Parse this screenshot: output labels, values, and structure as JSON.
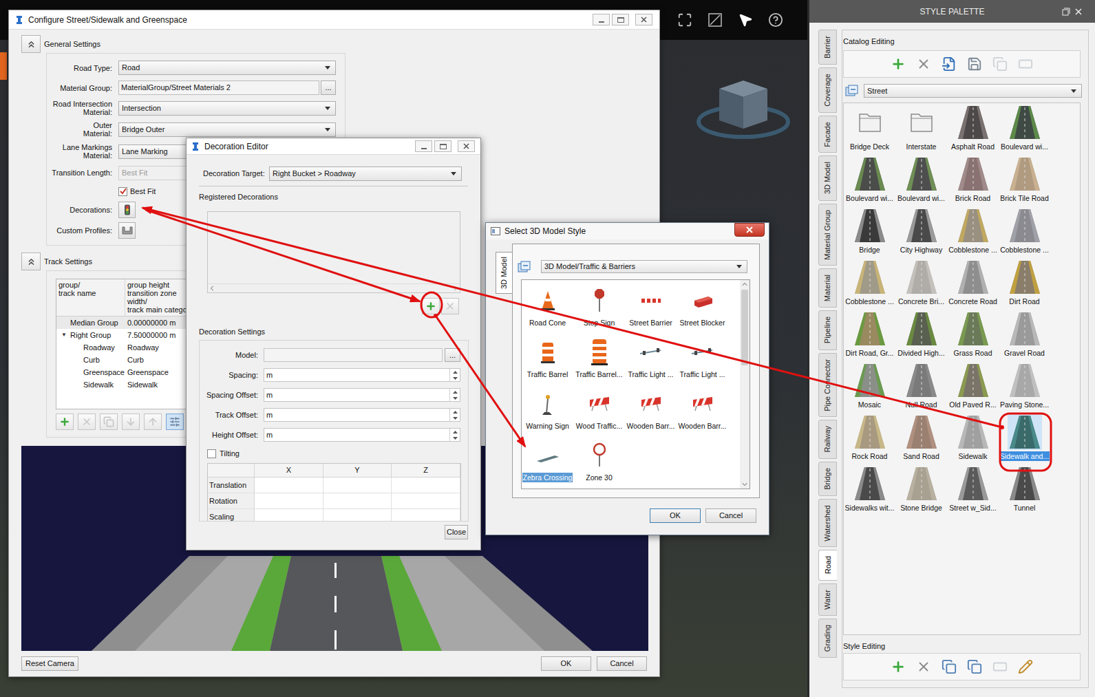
{
  "main_window": {
    "title": "Configure Street/Sidewalk and Greenspace",
    "general": {
      "title": "General Settings",
      "expanded": true,
      "fields": [
        {
          "kind": "combo",
          "label": [
            "Road Type:"
          ],
          "value": "Road",
          "disabled": false
        },
        {
          "kind": "browse",
          "label": [
            "Material Group:"
          ],
          "value": "MaterialGroup/Street Materials 2",
          "button": "...",
          "disabled": false
        },
        {
          "kind": "combo",
          "label": [
            "Road Intersection",
            "Material:"
          ],
          "value": "Intersection",
          "disabled": false
        },
        {
          "kind": "combo",
          "label": [
            "Outer",
            "Material:"
          ],
          "value": "Bridge Outer",
          "disabled": false
        },
        {
          "kind": "combo",
          "label": [
            "Lane Markings",
            "Material:"
          ],
          "value": "Lane Marking",
          "disabled": false
        },
        {
          "kind": "combo",
          "label": [
            "Transition Length:"
          ],
          "value": "Best Fit",
          "disabled": true
        },
        {
          "kind": "checkbox",
          "label": [],
          "value": "Best Fit",
          "checked": true,
          "disabled": false
        },
        {
          "kind": "decorations",
          "label": [
            "Decorations:"
          ],
          "disabled": false
        },
        {
          "kind": "profiles",
          "label": [
            "Custom Profiles:"
          ],
          "disabled": false
        }
      ]
    },
    "track": {
      "title": "Track Settings",
      "expanded": true,
      "expand_glyph": "▼",
      "columns": [
        [
          "group/",
          "track name"
        ],
        [
          "group height",
          "transition zone",
          "width/",
          "track main categor"
        ]
      ],
      "rows": [
        {
          "name": "Median Group",
          "value": "0.00000000 m",
          "kind": "group",
          "has_children": false
        },
        {
          "name": "Right Group",
          "value": "7.50000000 m",
          "kind": "group",
          "has_children": true
        },
        {
          "name": "Roadway",
          "value": "Roadway",
          "kind": "track",
          "has_children": false
        },
        {
          "name": "Curb",
          "value": "Curb",
          "kind": "track",
          "has_children": false
        },
        {
          "name": "Greenspace",
          "value": "Greenspace",
          "kind": "track",
          "has_children": false
        },
        {
          "name": "Sidewalk",
          "value": "Sidewalk",
          "kind": "track",
          "has_children": false
        }
      ],
      "tools": [
        {
          "disabled": false,
          "pressed": false
        },
        {
          "disabled": true,
          "pressed": false
        },
        {
          "disabled": true,
          "pressed": false
        },
        {
          "disabled": true,
          "pressed": false
        },
        {
          "disabled": true,
          "pressed": false
        },
        {
          "disabled": false,
          "pressed": true
        }
      ]
    },
    "buttons": {
      "reset": "Reset Camera",
      "ok": "OK",
      "cancel": "Cancel"
    }
  },
  "decoration_editor": {
    "title": "Decoration Editor",
    "target_label": "Decoration Target:",
    "target": "Right Bucket > Roadway",
    "registered_title": "Registered Decorations",
    "registered": [],
    "tools": [
      {
        "disabled": false
      },
      {
        "disabled": true
      }
    ],
    "settings_title": "Decoration Settings",
    "model": {
      "label": "Model:",
      "value": "",
      "button": "..."
    },
    "spins": [
      {
        "label": "Spacing:",
        "value": "m"
      },
      {
        "label": "Spacing Offset:",
        "value": "m"
      },
      {
        "label": "Track Offset:",
        "value": "m"
      },
      {
        "label": "Height Offset:",
        "value": "m"
      }
    ],
    "tilting": {
      "label": "Tilting",
      "checked": false
    },
    "transform": {
      "columns": [
        "X",
        "Y",
        "Z"
      ],
      "rows": [
        "Translation",
        "Rotation",
        "Scaling"
      ]
    },
    "close": "Close"
  },
  "model_dialog": {
    "title": "Select 3D Model Style",
    "tab": "3D Model",
    "category": "3D Model/Traffic & Barriers",
    "items": [
      {
        "name": "Road Cone",
        "kind": "cone",
        "color": "#e8691b",
        "selected": false
      },
      {
        "name": "Stop Sign",
        "kind": "sign",
        "color": "#c0392b",
        "selected": false
      },
      {
        "name": "Street Barrier",
        "kind": "barrier",
        "color": "#d9342b",
        "selected": false
      },
      {
        "name": "Street Blocker",
        "kind": "blocker",
        "color": "#c9302c",
        "selected": false
      },
      {
        "name": "Traffic Barrel",
        "kind": "barrel",
        "color": "#e8661a",
        "selected": false
      },
      {
        "name": "Traffic Barrel...",
        "kind": "barrel2",
        "color": "#e8661a",
        "selected": false
      },
      {
        "name": "Traffic Light ...",
        "kind": "light",
        "color": "#6b8a96",
        "selected": false
      },
      {
        "name": "Traffic Light ...",
        "kind": "light",
        "color": "#6b8a96",
        "selected": false
      },
      {
        "name": "Warning Sign",
        "kind": "warning",
        "color": "#e0a020",
        "selected": false
      },
      {
        "name": "Wood Traffic...",
        "kind": "wood",
        "color": "#d9342b",
        "selected": false
      },
      {
        "name": "Wooden Barr...",
        "kind": "wood",
        "color": "#d9342b",
        "selected": false
      },
      {
        "name": "Wooden Barr...",
        "kind": "wood",
        "color": "#d9342b",
        "selected": false
      },
      {
        "name": "Zebra Crossing",
        "kind": "crossing",
        "color": "#5f7a80",
        "selected": true
      },
      {
        "name": "Zone 30",
        "kind": "zone",
        "color": "#c0392b",
        "selected": false
      }
    ],
    "buttons": [
      "OK",
      "Cancel"
    ]
  },
  "style_palette": {
    "title": "STYLE PALETTE",
    "tabs": [
      {
        "label": "Barrier",
        "selected": false
      },
      {
        "label": "Coverage",
        "selected": false
      },
      {
        "label": "Facade",
        "selected": false
      },
      {
        "label": "3D Model",
        "selected": false
      },
      {
        "label": "Material Group",
        "selected": false
      },
      {
        "label": "Material",
        "selected": false
      },
      {
        "label": "Pipeline",
        "selected": false
      },
      {
        "label": "Pipe Connector",
        "selected": false
      },
      {
        "label": "Railway",
        "selected": false
      },
      {
        "label": "Bridge",
        "selected": false
      },
      {
        "label": "Watershed",
        "selected": false
      },
      {
        "label": "Road",
        "selected": true
      },
      {
        "label": "Water",
        "selected": false
      },
      {
        "label": "Grading",
        "selected": false
      }
    ],
    "catalog_title": "Catalog Editing",
    "catalog_tools": [
      {
        "disabled": false
      },
      {
        "disabled": false
      },
      {
        "disabled": false
      },
      {
        "disabled": false
      },
      {
        "disabled": true
      },
      {
        "disabled": true
      }
    ],
    "category": "Street",
    "items": [
      {
        "name": "Bridge Deck",
        "kind": "folder",
        "color": "#f2f2f2",
        "edge": "#8a8a8a",
        "selected": false
      },
      {
        "name": "Interstate",
        "kind": "folder",
        "color": "#f2f2f2",
        "edge": "#8a8a8a",
        "selected": false
      },
      {
        "name": "Asphalt Road",
        "kind": "road",
        "color": "#4d4948",
        "edge": "#7a7270",
        "selected": false
      },
      {
        "name": "Boulevard wi...",
        "kind": "road",
        "color": "#3f4a44",
        "edge": "#5d8a4a",
        "selected": false
      },
      {
        "name": "Boulevard wi...",
        "kind": "road",
        "color": "#4a4d4a",
        "edge": "#6a8a50",
        "selected": false
      },
      {
        "name": "Boulevard wi...",
        "kind": "road",
        "color": "#4e4e4e",
        "edge": "#6f8f55",
        "selected": false
      },
      {
        "name": "Brick Road",
        "kind": "road",
        "color": "#8a7272",
        "edge": "#a08a8a",
        "selected": false
      },
      {
        "name": "Brick Tile Road",
        "kind": "road",
        "color": "#b09a80",
        "edge": "#c8b090",
        "selected": false
      },
      {
        "name": "Bridge",
        "kind": "road",
        "color": "#3a3a3a",
        "edge": "#8a8a8a",
        "selected": false
      },
      {
        "name": "City Highway",
        "kind": "road",
        "color": "#4a4a4a",
        "edge": "#9a9a9a",
        "selected": false
      },
      {
        "name": "Cobblestone ...",
        "kind": "road",
        "color": "#9a9080",
        "edge": "#c0a860",
        "selected": false
      },
      {
        "name": "Cobblestone ...",
        "kind": "road",
        "color": "#8a8a90",
        "edge": "#a0a0a8",
        "selected": false
      },
      {
        "name": "Cobblestone ...",
        "kind": "road",
        "color": "#a09a88",
        "edge": "#c8b478",
        "selected": false
      },
      {
        "name": "Concrete Bri...",
        "kind": "road",
        "color": "#b0aca8",
        "edge": "#c4c0bc",
        "selected": false
      },
      {
        "name": "Concrete Road",
        "kind": "road",
        "color": "#8e8e8e",
        "edge": "#b0b0b0",
        "selected": false
      },
      {
        "name": "Dirt Road",
        "kind": "road",
        "color": "#8a7e6a",
        "edge": "#c0a040",
        "selected": false
      },
      {
        "name": "Dirt Road, Gr...",
        "kind": "road",
        "color": "#9a8a60",
        "edge": "#6a9a40",
        "selected": false
      },
      {
        "name": "Divided High...",
        "kind": "road",
        "color": "#5a6050",
        "edge": "#6a8a40",
        "selected": false
      },
      {
        "name": "Grass Road",
        "kind": "road",
        "color": "#6a7a58",
        "edge": "#7a9a50",
        "selected": false
      },
      {
        "name": "Gravel Road",
        "kind": "road",
        "color": "#9a9a9a",
        "edge": "#b8b8b8",
        "selected": false
      },
      {
        "name": "Mosaic",
        "kind": "road",
        "color": "#8a9088",
        "edge": "#6a9a50",
        "selected": false
      },
      {
        "name": "Null Road",
        "kind": "road",
        "color": "#7a7a7a",
        "edge": "#8a8a8a",
        "selected": false
      },
      {
        "name": "Old Paved R...",
        "kind": "road",
        "color": "#7a7468",
        "edge": "#8a9a50",
        "selected": false
      },
      {
        "name": "Paving Stone...",
        "kind": "road",
        "color": "#a8a8a8",
        "edge": "#c0c0c0",
        "selected": false
      },
      {
        "name": "Rock Road",
        "kind": "road",
        "color": "#a89a80",
        "edge": "#c8b888",
        "selected": false
      },
      {
        "name": "Sand Road",
        "kind": "road",
        "color": "#9a8070",
        "edge": "#b09080",
        "selected": false
      },
      {
        "name": "Sidewalk",
        "kind": "road",
        "color": "#a0a0a0",
        "edge": "#b8b8b8",
        "selected": false
      },
      {
        "name": "Sidewalk and...",
        "kind": "road",
        "color": "#3a6a6a",
        "edge": "#4a8a8a",
        "selected": true
      },
      {
        "name": "Sidewalks wit...",
        "kind": "road",
        "color": "#4a4a4a",
        "edge": "#8a8a8a",
        "selected": false
      },
      {
        "name": "Stone Bridge",
        "kind": "road",
        "color": "#a8a090",
        "edge": "#b8b0a0",
        "selected": false
      },
      {
        "name": "Street w_Sid...",
        "kind": "road",
        "color": "#5a5a5a",
        "edge": "#9a9a9a",
        "selected": false
      },
      {
        "name": "Tunnel",
        "kind": "road",
        "color": "#4a4a4a",
        "edge": "#8a8a8a",
        "selected": false
      }
    ],
    "style_title": "Style Editing",
    "style_tools": [
      {
        "disabled": false
      },
      {
        "disabled": false
      },
      {
        "disabled": false
      },
      {
        "disabled": false
      },
      {
        "disabled": true
      },
      {
        "disabled": false
      }
    ]
  }
}
